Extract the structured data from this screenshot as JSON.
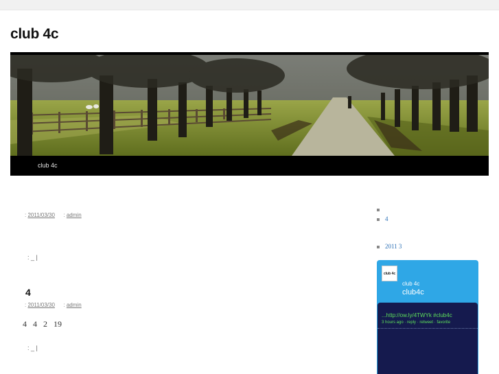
{
  "site": {
    "title": "club 4c"
  },
  "nav": {
    "items": [
      {
        "label": "club 4c"
      }
    ]
  },
  "posts": [
    {
      "title": "",
      "date": "2011/03/30",
      "author": "admin",
      "meta_prefix": ":",
      "author_prefix": ":",
      "body": "",
      "footer": ": _ |"
    },
    {
      "title": "4",
      "date": "2011/03/30",
      "author": "admin",
      "meta_prefix": ":",
      "author_prefix": ":",
      "body": "4  4 2  19",
      "footer": ": _ |"
    }
  ],
  "sidebar": {
    "recent_posts": [
      {
        "label": ""
      },
      {
        "label": "4"
      }
    ],
    "archives": [
      {
        "label": "2011 3"
      }
    ]
  },
  "twitter": {
    "logo_text": "club 4c",
    "name": "club 4c",
    "handle": "club4c",
    "tweet": "...http://ow.ly/4TWYk #club4c",
    "meta": "3 hours ago · reply · retweet · favorite"
  },
  "colors": {
    "twitter_header": "#2fa7e6",
    "twitter_body": "#151a4e",
    "tweet_text": "#5ee05a",
    "link": "#2a6fb5"
  }
}
